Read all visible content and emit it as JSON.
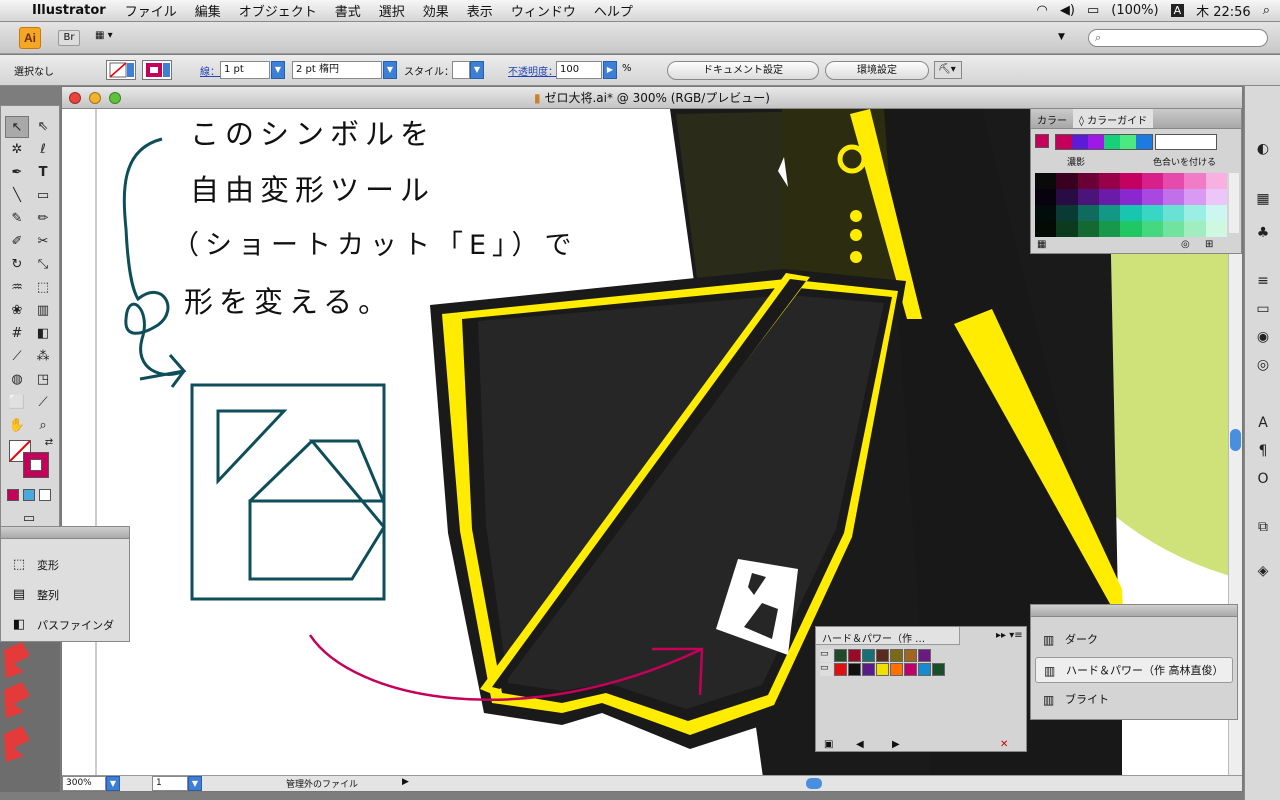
{
  "menubar": {
    "app": "Illustrator",
    "menus": [
      "ファイル",
      "編集",
      "オブジェクト",
      "書式",
      "選択",
      "効果",
      "表示",
      "ウィンドウ",
      "ヘルプ"
    ],
    "battery": "(100%)",
    "clock": "木 22:56"
  },
  "appbar": {
    "logo": "Ai",
    "bridge": "Br"
  },
  "control": {
    "selection": "選択なし",
    "stroke_label": "線：",
    "stroke_value": "1 pt",
    "brush": "2 pt 楕円",
    "style_label": "スタイル：",
    "opacity_label": "不透明度：",
    "opacity_value": "100",
    "percent": "%",
    "doc_setup": "ドキュメント設定",
    "prefs": "環境設定"
  },
  "document": {
    "title": "ゼロ大将.ai* @ 300% (RGB/プレビュー)",
    "note_lines": [
      "このシンボルを",
      "自由変形ツール",
      "（ショートカット「E」）で",
      "形を変える。"
    ],
    "zoom": "300%",
    "page": "1",
    "status": "管理外のファイル"
  },
  "mini_panel": {
    "items": [
      {
        "label": "変形",
        "icon": "transform-icon"
      },
      {
        "label": "整列",
        "icon": "align-icon"
      },
      {
        "label": "パスファインダ",
        "icon": "pathfinder-icon"
      }
    ]
  },
  "color_panel": {
    "tab_color": "カラー",
    "tab_guide": "◊ カラーガイド",
    "shade_label": "濃影",
    "vivid_label": "色合いを付ける",
    "harmony": [
      "#c4005a",
      "#5c1bd6",
      "#a018e8",
      "#18d07a",
      "#4ce880",
      "#1c7ae0"
    ],
    "grid_colors": [
      "#0a0a0a",
      "#3a0020",
      "#6a0035",
      "#98004a",
      "#c40060",
      "#d8208a",
      "#e64aaa",
      "#f07cc8",
      "#f8b0e0",
      "#08020e",
      "#2a0c44",
      "#4a1478",
      "#6a1ca8",
      "#8a28d0",
      "#a848e0",
      "#c270ea",
      "#d89af2",
      "#ecc6f8",
      "#020c0a",
      "#0a3a34",
      "#106a5e",
      "#149886",
      "#18c6b0",
      "#38d6c4",
      "#68e2d4",
      "#9aeee4",
      "#ccf6f0",
      "#040a04",
      "#0c3a1c",
      "#126a32",
      "#18984a",
      "#20c864",
      "#44d880",
      "#70e49e",
      "#a0eec0",
      "#d0f8e0"
    ]
  },
  "swatch_panel": {
    "title": "ハード＆パワー（作 …",
    "row1": [
      "#1e4a2a",
      "#9a0a28",
      "#1a6e76",
      "#5a2a1e",
      "#7a6a18",
      "#a0681e",
      "#6a1a80"
    ],
    "row2": [
      "#e01010",
      "#111111",
      "#5a1a8a",
      "#f0e000",
      "#ff7000",
      "#c0006a",
      "#1a8ad0",
      "#1a4e2a"
    ]
  },
  "group_panel": {
    "items": [
      {
        "label": "ダーク",
        "selected": false
      },
      {
        "label": "ハード＆パワー（作 高林直俊）",
        "selected": true
      },
      {
        "label": "ブライト",
        "selected": false
      }
    ]
  },
  "colors": {
    "accent_magenta": "#c4005a",
    "teal_stroke": "#0e4e5a",
    "dark_fill": "#252525",
    "yellow": "#ffec00",
    "lime": "#cfe27a"
  }
}
